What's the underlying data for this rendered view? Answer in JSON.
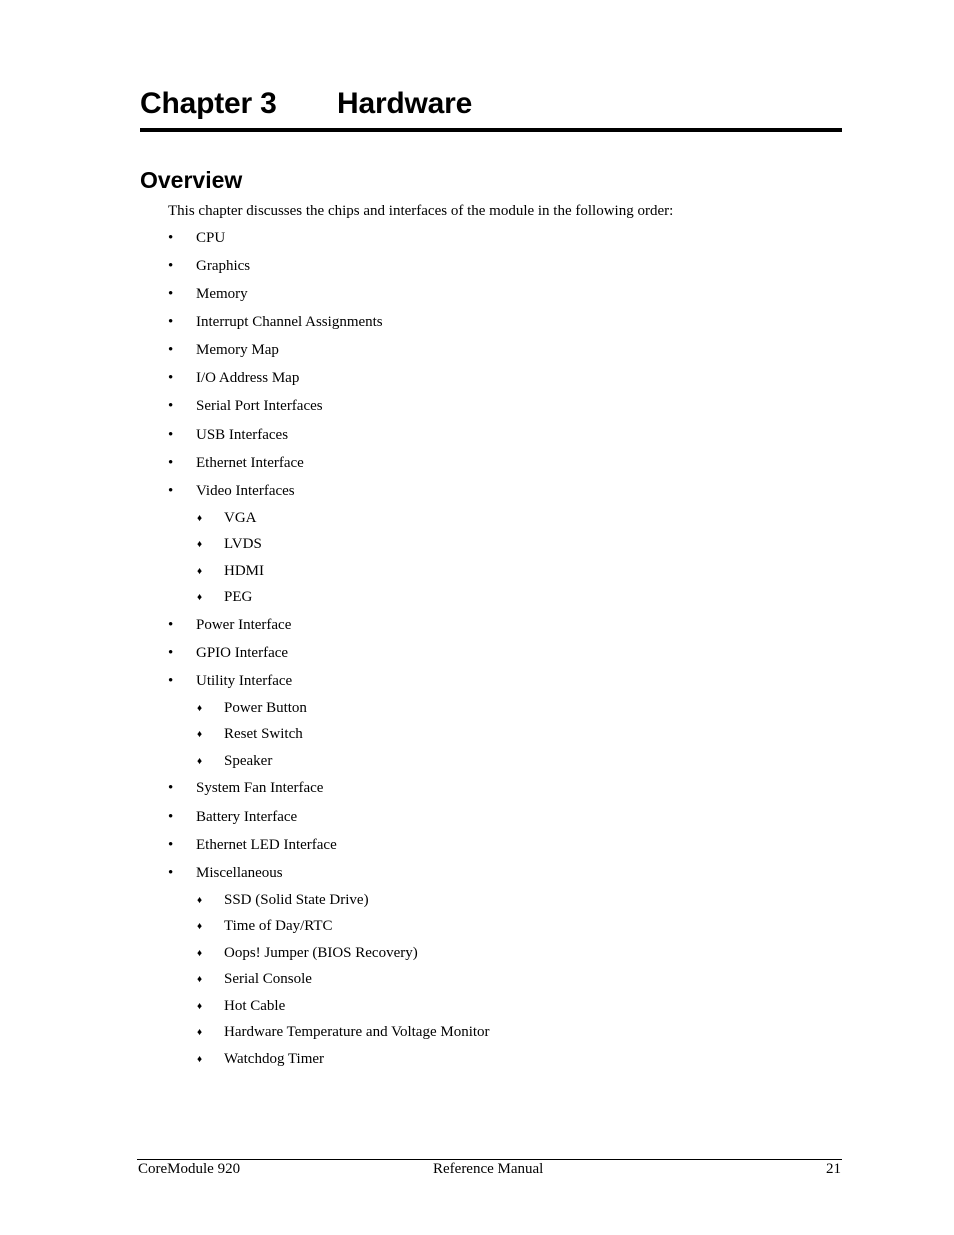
{
  "chapter": {
    "number": "Chapter 3",
    "title": "Hardware"
  },
  "section": {
    "title": "Overview"
  },
  "intro": "This chapter discusses the chips and interfaces of the module in the following order:",
  "bullets": {
    "level1": "•",
    "level2": "♦"
  },
  "items": [
    {
      "label": "CPU",
      "level": 1
    },
    {
      "label": "Graphics",
      "level": 1
    },
    {
      "label": "Memory",
      "level": 1
    },
    {
      "label": "Interrupt Channel Assignments",
      "level": 1
    },
    {
      "label": "Memory Map",
      "level": 1
    },
    {
      "label": "I/O Address Map",
      "level": 1
    },
    {
      "label": "Serial Port Interfaces",
      "level": 1
    },
    {
      "label": "USB Interfaces",
      "level": 1
    },
    {
      "label": "Ethernet Interface",
      "level": 1
    },
    {
      "label": "Video Interfaces",
      "level": 1
    },
    {
      "label": "VGA",
      "level": 2
    },
    {
      "label": "LVDS",
      "level": 2
    },
    {
      "label": "HDMI",
      "level": 2
    },
    {
      "label": "PEG",
      "level": 2
    },
    {
      "label": "Power Interface",
      "level": 1
    },
    {
      "label": "GPIO Interface",
      "level": 1
    },
    {
      "label": "Utility Interface",
      "level": 1
    },
    {
      "label": "Power Button",
      "level": 2
    },
    {
      "label": "Reset Switch",
      "level": 2
    },
    {
      "label": "Speaker",
      "level": 2
    },
    {
      "label": "System Fan Interface",
      "level": 1
    },
    {
      "label": "Battery Interface",
      "level": 1
    },
    {
      "label": "Ethernet LED Interface",
      "level": 1
    },
    {
      "label": "Miscellaneous",
      "level": 1
    },
    {
      "label": "SSD (Solid State Drive)",
      "level": 2
    },
    {
      "label": "Time of Day/RTC",
      "level": 2
    },
    {
      "label": "Oops! Jumper (BIOS Recovery)",
      "level": 2
    },
    {
      "label": "Serial Console",
      "level": 2
    },
    {
      "label": "Hot Cable",
      "level": 2
    },
    {
      "label": "Hardware Temperature and Voltage Monitor",
      "level": 2
    },
    {
      "label": "Watchdog Timer",
      "level": 2
    }
  ],
  "footer": {
    "left": "CoreModule 920",
    "center": "Reference Manual",
    "right": "21"
  }
}
